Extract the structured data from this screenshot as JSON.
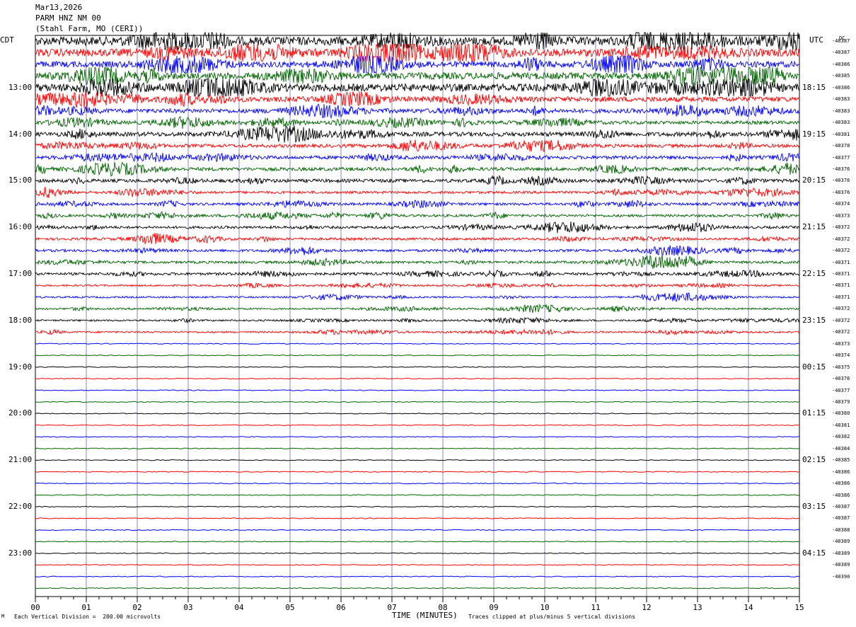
{
  "header": {
    "date": "Mar13,2026",
    "channel": "PARM HNZ NM 00",
    "location": "(Stahl Farm, MO (CERI))"
  },
  "left_timezone": "CDT",
  "right_timezone": "UTC",
  "dc_label": "DC",
  "footer": {
    "scale": "Each Vertical Division =  200.00 microvolts",
    "clip": "Traces clipped at plus/minus 5 vertical divisions",
    "corner_mark": "M"
  },
  "colors": [
    "#000000",
    "#ff0000",
    "#0000ff",
    "#006400"
  ],
  "chart_data": {
    "type": "line",
    "title": "",
    "xlabel": "TIME (MINUTES)",
    "xlim": [
      0,
      15
    ],
    "x_ticks": [
      "00",
      "01",
      "02",
      "03",
      "04",
      "05",
      "06",
      "07",
      "08",
      "09",
      "10",
      "11",
      "12",
      "13",
      "14",
      "15"
    ],
    "left_hour_labels": [
      "13:00",
      "14:00",
      "15:00",
      "16:00",
      "17:00",
      "18:00",
      "19:00",
      "20:00",
      "21:00",
      "22:00",
      "23:00"
    ],
    "right_hour_labels": [
      "18:15",
      "19:15",
      "20:15",
      "21:15",
      "22:15",
      "23:15",
      "00:15",
      "01:15",
      "02:15",
      "03:15",
      "04:15"
    ],
    "dc_offsets": [
      "-40387",
      "-40387",
      "-40386",
      "-40385",
      "-40386",
      "-40383",
      "-40383",
      "-40383",
      "-40381",
      "-40378",
      "-40377",
      "-40376",
      "-40376",
      "-40376",
      "-40374",
      "-40373",
      "-40372",
      "-40372",
      "-40372",
      "-40371",
      "-40371",
      "-40371",
      "-40371",
      "-40372",
      "-40372",
      "-40372",
      "-40373",
      "-40374",
      "-40375",
      "-40376",
      "-40377",
      "-40379",
      "-40380",
      "-40381",
      "-40382",
      "-40384",
      "-40385",
      "-40386",
      "-40386",
      "-40386",
      "-40387",
      "-40387",
      "-40388",
      "-40389",
      "-40389",
      "-40389",
      "-40390"
    ],
    "trace_amplitude": [
      10,
      9,
      7,
      8,
      9,
      6,
      5,
      4,
      5,
      4,
      4,
      4,
      4,
      3,
      3,
      3,
      3,
      3,
      3,
      3,
      3,
      2,
      2,
      2,
      2,
      2,
      0.6,
      0.6,
      0.6,
      0.6,
      0.6,
      0.6,
      0.6,
      0.6,
      0.6,
      0.6,
      0.6,
      0.6,
      0.6,
      0.6,
      0.6,
      0.6,
      0.6,
      0.6,
      0.6,
      0.6,
      0.6,
      0.6
    ]
  }
}
